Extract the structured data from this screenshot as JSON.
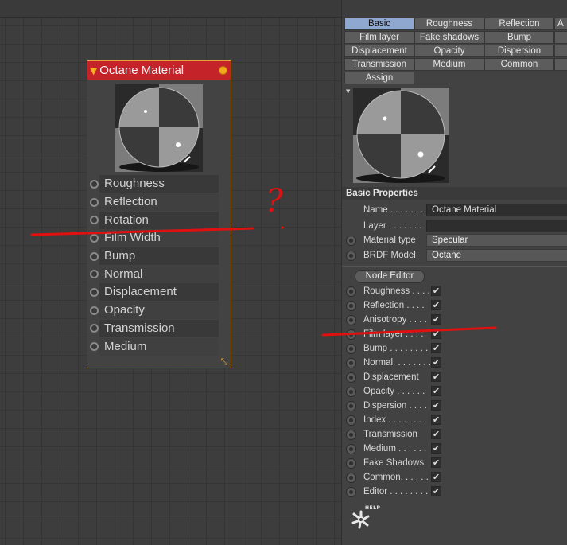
{
  "node": {
    "title": "Octane Material",
    "ports": [
      "Roughness",
      "Reflection",
      "Rotation",
      "Film Width",
      "Bump",
      "Normal",
      "Displacement",
      "Opacity",
      "Transmission",
      "Medium"
    ]
  },
  "panel": {
    "tabs": [
      "Basic",
      "Roughness",
      "Reflection",
      "A",
      "Film layer",
      "Fake shadows",
      "Bump",
      "",
      "Displacement",
      "Opacity",
      "Dispersion",
      "",
      "Transmission",
      "Medium",
      "Common",
      "",
      "Assign"
    ],
    "active_tab": "Basic",
    "section_title": "Basic Properties",
    "name_label": "Name . . . . . . .",
    "name_value": "Octane Material",
    "layer_label": "Layer . . . . . . .",
    "layer_value": "",
    "material_type_label": "Material type",
    "material_type_value": "Specular",
    "brdf_label": "BRDF Model",
    "brdf_value": "Octane",
    "node_editor_button": "Node Editor",
    "channels": [
      {
        "label": "Roughness . . . .",
        "checked": true
      },
      {
        "label": "Reflection . . . .",
        "checked": true
      },
      {
        "label": "Anisotropy . . . .",
        "checked": true
      },
      {
        "label": "Film layer . . . .",
        "checked": true
      },
      {
        "label": "Bump . . . . . . . .",
        "checked": true
      },
      {
        "label": "Normal. . . . . . . .",
        "checked": true
      },
      {
        "label": "Displacement",
        "checked": true
      },
      {
        "label": "Opacity . . . . . .",
        "checked": true
      },
      {
        "label": "Dispersion . . . .",
        "checked": true
      },
      {
        "label": "Index . . . . . . . .",
        "checked": true
      },
      {
        "label": "Transmission",
        "checked": true
      },
      {
        "label": "Medium . . . . . .",
        "checked": true
      },
      {
        "label": "Fake Shadows",
        "checked": true
      },
      {
        "label": "Common. . . . . .",
        "checked": true
      },
      {
        "label": "Editor . . . . . . . .",
        "checked": true
      }
    ],
    "check_mark": "✔",
    "help_text": "HELP"
  },
  "annotation": {
    "question_mark": "?",
    "color": "#e01010"
  },
  "colors": {
    "node_header": "#c4232a",
    "node_border": "#e3a338",
    "active_tab": "#8fa8cf"
  }
}
